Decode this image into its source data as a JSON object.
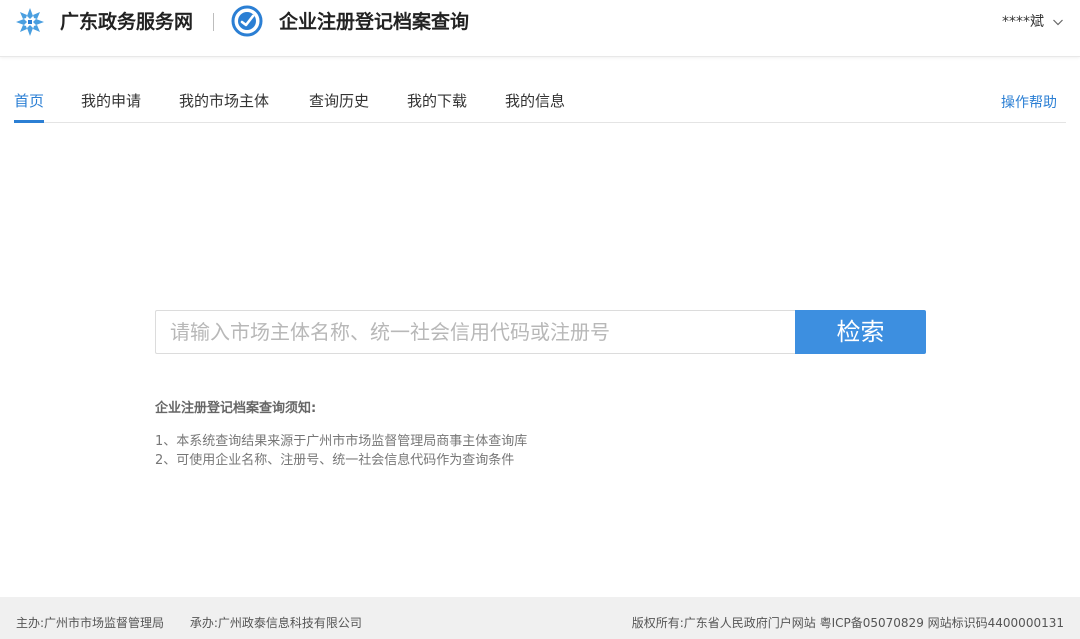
{
  "header": {
    "site_name": "广东政务服务网",
    "app_title": "企业注册登记档案查询",
    "user_name": "****斌",
    "colors": {
      "accent": "#2b7fd4",
      "logo_blue": "#4a9fe0",
      "button": "#3d8fe0"
    }
  },
  "nav": {
    "tabs": [
      {
        "label": "首页",
        "active": true
      },
      {
        "label": "我的申请",
        "active": false
      },
      {
        "label": "我的市场主体",
        "active": false
      },
      {
        "label": "查询历史",
        "active": false
      },
      {
        "label": "我的下载",
        "active": false
      },
      {
        "label": "我的信息",
        "active": false
      }
    ],
    "help": "操作帮助"
  },
  "search": {
    "placeholder": "请输入市场主体名称、统一社会信用代码或注册号",
    "value": "",
    "button_label": "检索"
  },
  "notice": {
    "title": "企业注册登记档案查询须知:",
    "items": [
      "1、本系统查询结果来源于广州市市场监督管理局商事主体查询库",
      "2、可使用企业名称、注册号、统一社会信息代码作为查询条件"
    ]
  },
  "footer": {
    "sponsor": "主办:广州市市场监督管理局",
    "organizer": "承办:广州政泰信息科技有限公司",
    "copyright": "版权所有:广东省人民政府门户网站 粤ICP备05070829 网站标识码4400000131"
  },
  "icons": {
    "logo": "guangdong-gov-logo-icon",
    "app": "archive-query-logo-icon",
    "dropdown": "chevron-down-icon"
  }
}
